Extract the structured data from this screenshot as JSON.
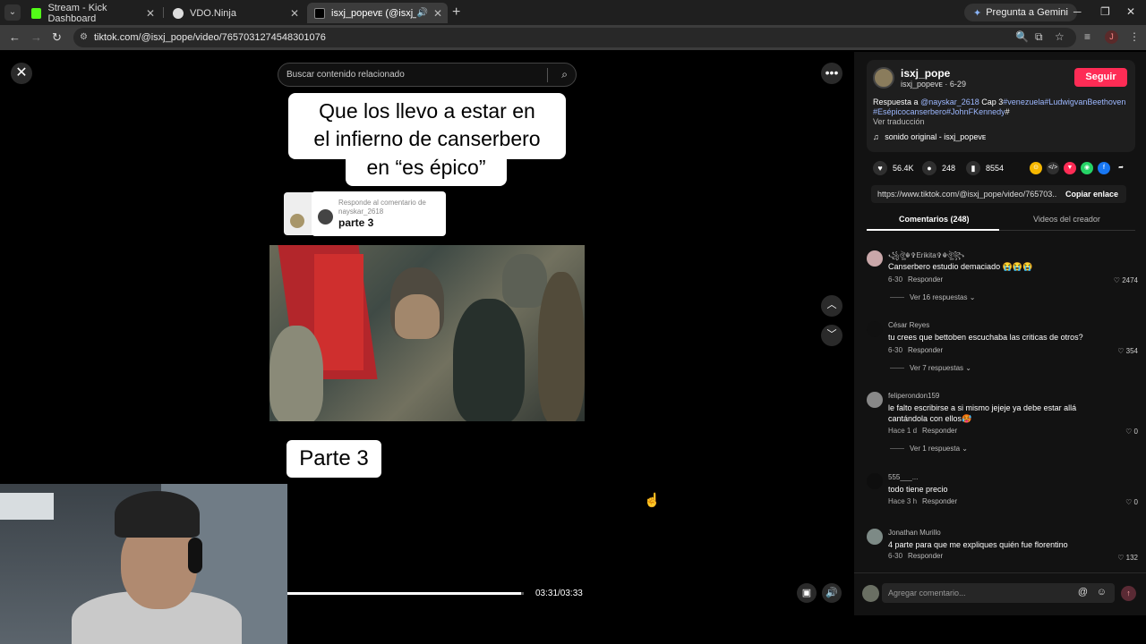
{
  "browser": {
    "tabs": [
      {
        "label": "Stream - Kick Dashboard",
        "color": "#53fc18"
      },
      {
        "label": "VDO.Ninja",
        "color": "#dddddd"
      },
      {
        "label": "isxj_popeᴠᴇ (@isxj_pope) |",
        "color": "#ffffff"
      }
    ],
    "gemini_label": "Pregunta a Gemini",
    "url": "tiktok.com/@isxj_pope/video/7657031274548301076",
    "profile_initial": "J"
  },
  "video": {
    "search_placeholder": "Buscar contenido relacionado",
    "title_line1": "Que los llevo a estar en",
    "title_line2": "el infierno de canserbero",
    "title_line3": "en “es épico”",
    "reply_header": "Responde al comentario de nayskar_2618",
    "reply_text": "parte 3",
    "parte_label": "Parte 3",
    "time": "03:31/03:33",
    "progress": 0.99
  },
  "creator": {
    "username": "isxj_pope",
    "subline": "isxj_popeᴠᴇ · 6-29",
    "follow_label": "Seguir",
    "desc_prefix": "Respuesta a",
    "desc_mention": "@nayskar_2618",
    "desc_mid": "Cap 3",
    "desc_tags1": "#venezuela#LudwigvanBeethoven",
    "desc_tags2": "#Esépicocanserbero#JohnFKennedy",
    "desc_hash": "#",
    "translate": "Ver traducción",
    "sound": "sonido original - isxj_popeᴠᴇ"
  },
  "stats": {
    "likes": "56.4K",
    "comments": "248",
    "saves": "8554"
  },
  "link": {
    "url": "https://www.tiktok.com/@isxj_pope/video/765703...",
    "copy_label": "Copiar enlace"
  },
  "panel_tabs": {
    "comments": "Comentarios (248)",
    "creator_videos": "Videos del creador"
  },
  "comments": [
    {
      "name": "꧁ঔৣ☬✞Erikita✞☬ঔৣ꧂",
      "text": "Canserbero estudio demaciado 😭😭😭",
      "date": "6-30",
      "reply": "Responder",
      "likes": "2474",
      "replies": "Ver 16 respuestas"
    },
    {
      "name": "César Reyes",
      "text": "tu crees que bettoben escuchaba las criticas de otros?",
      "date": "6-30",
      "reply": "Responder",
      "likes": "354",
      "replies": "Ver 7 respuestas"
    },
    {
      "name": "feliperondon159",
      "text": "le falto escribirse a si mismo jejeje ya debe estar allá cantándola con ellos🥵",
      "date": "Hace 1 d",
      "reply": "Responder",
      "likes": "0",
      "replies": "Ver 1 respuesta"
    },
    {
      "name": "555___...",
      "text": "todo tiene precio",
      "date": "Hace 3 h",
      "reply": "Responder",
      "likes": "0",
      "replies": ""
    },
    {
      "name": "Jonathan Murillo",
      "text": "4 parte para que me expliques quién fue florentino",
      "date": "6-30",
      "reply": "Responder",
      "likes": "132",
      "replies": ""
    }
  ],
  "comment_input": {
    "placeholder": "Agregar comentario..."
  }
}
